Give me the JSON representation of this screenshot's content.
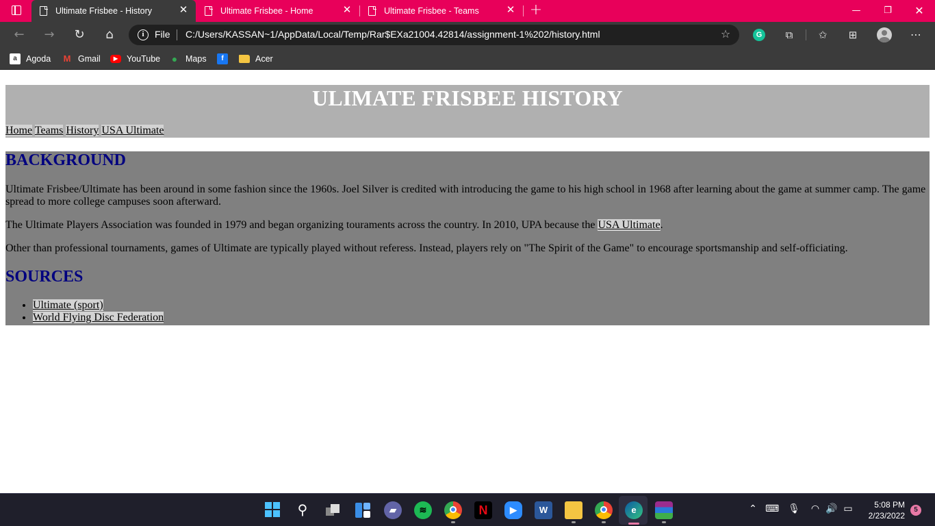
{
  "browser": {
    "tabs": [
      {
        "title": "Ultimate Frisbee - History",
        "active": true
      },
      {
        "title": "Ultimate Frisbee - Home",
        "active": false
      },
      {
        "title": "Ultimate Frisbee - Teams",
        "active": false
      }
    ],
    "address": {
      "scheme_label": "File",
      "url": "C:/Users/KASSAN~1/AppData/Local/Temp/Rar$EXa21004.42814/assignment-1%202/history.html"
    },
    "favorites": [
      {
        "label": "Agoda",
        "icon": "agoda-icon"
      },
      {
        "label": "Gmail",
        "icon": "gmail-icon"
      },
      {
        "label": "YouTube",
        "icon": "youtube-icon"
      },
      {
        "label": "Maps",
        "icon": "maps-icon"
      },
      {
        "label": "",
        "icon": "facebook-icon"
      },
      {
        "label": "Acer",
        "icon": "folder-icon"
      }
    ],
    "colors": {
      "tab_strip": "#e8005a",
      "toolbar": "#3b3b3b"
    }
  },
  "page": {
    "title": "ULIMATE FRISBEE HISTORY",
    "nav": [
      "Home",
      "Teams",
      "History",
      "USA Ultimate"
    ],
    "background_heading": "BACKGROUND",
    "paragraphs": {
      "p1": "Ultimate Frisbee/Ultimate has been around in some fashion since the 1960s. Joel Silver is credited with introducing the game to his high school in 1968 after learning about the game at summer camp. The game spread to more college campuses soon afterward.",
      "p2_before": "The Ultimate Players Association was founded in 1979 and began organizing touraments across the country. In 2010, UPA because the ",
      "p2_link": "USA Ultimate",
      "p2_after": ".",
      "p3": "Other than professional tournaments, games of Ultimate are typically played without referess. Instead, players rely on \"The Spirit of the Game\" to encourage sportsmanship and self-officiating."
    },
    "sources_heading": "SOURCES",
    "sources": [
      "Ultimate (sport)",
      "World Flying Disc Federation"
    ],
    "colors": {
      "header_bg": "#b0b0b0",
      "main_bg": "#808080",
      "heading": "#00007f",
      "link_bg": "#d3d3d3"
    }
  },
  "taskbar": {
    "apps": [
      "windows-start-icon",
      "search-icon",
      "task-view-icon",
      "widgets-icon",
      "teams-chat-icon",
      "spotify-icon",
      "chrome-icon",
      "netflix-icon",
      "zoom-icon",
      "word-icon",
      "file-explorer-icon",
      "chrome-icon",
      "edge-icon",
      "winrar-icon"
    ],
    "time": "5:08 PM",
    "date": "2/23/2022",
    "notifications": "5"
  }
}
